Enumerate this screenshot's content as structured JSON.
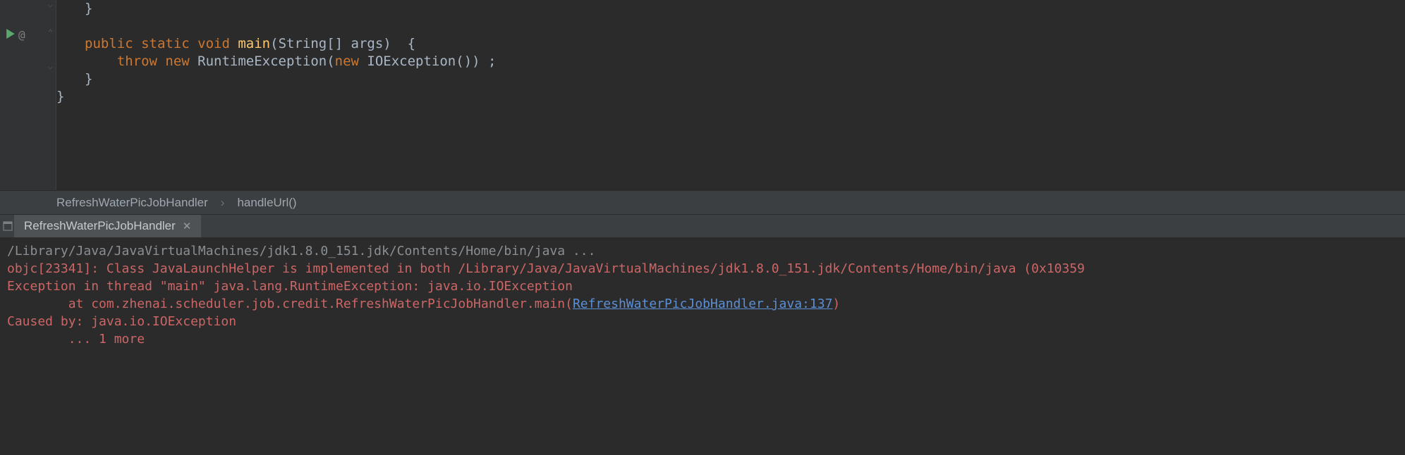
{
  "code": {
    "line1_frag": "}",
    "line3_public": "public ",
    "line3_static": "static ",
    "line3_void": "void ",
    "line3_main": "main",
    "line3_params": "(String[] args)  {",
    "line4_throw": "throw ",
    "line4_new1": "new ",
    "line4_rte": "RuntimeException",
    "line4_open": "(",
    "line4_new2": "new ",
    "line4_ioe": "IOException",
    "line4_close": "()) ;",
    "line5_close": "}",
    "line6_close": "}"
  },
  "breadcrumb": {
    "class": "RefreshWaterPicJobHandler",
    "method": "handleUrl()"
  },
  "run_tab": {
    "label": "RefreshWaterPicJobHandler"
  },
  "console": {
    "cmd": "/Library/Java/JavaVirtualMachines/jdk1.8.0_151.jdk/Contents/Home/bin/java ...",
    "objc": "objc[23341]: Class JavaLaunchHelper is implemented in both /Library/Java/JavaVirtualMachines/jdk1.8.0_151.jdk/Contents/Home/bin/java (0x10359",
    "exc": "Exception in thread \"main\" java.lang.RuntimeException: java.io.IOException",
    "at_prefix": "\tat com.zhenai.scheduler.job.credit.RefreshWaterPicJobHandler.main(",
    "at_link": "RefreshWaterPicJobHandler.java:137",
    "at_suffix": ")",
    "caused": "Caused by: java.io.IOException",
    "more": "\t... 1 more"
  }
}
